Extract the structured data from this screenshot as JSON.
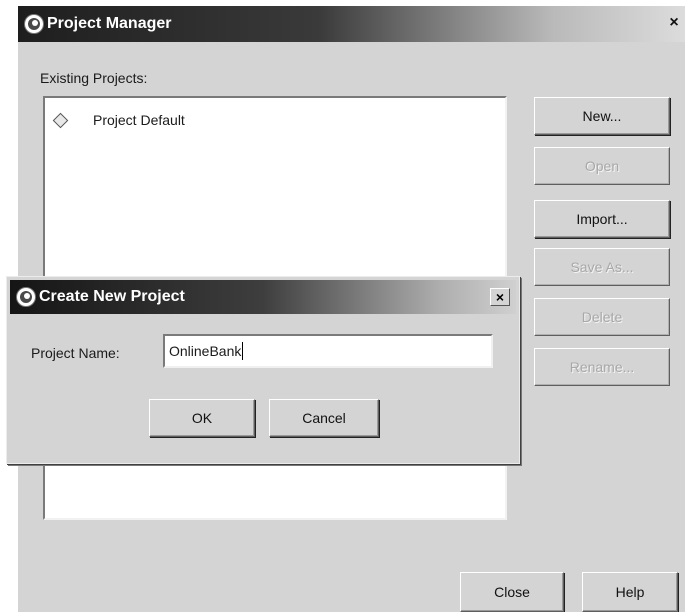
{
  "project_manager": {
    "title": "Project Manager",
    "close_glyph": "×",
    "existing_label": "Existing Projects:",
    "projects": [
      {
        "name": "Project Default",
        "icon": "diamond-icon"
      }
    ],
    "buttons": {
      "new": "New...",
      "open": "Open",
      "import": "Import...",
      "save_as": "Save As...",
      "delete": "Delete",
      "rename": "Rename...",
      "close": "Close",
      "help": "Help"
    }
  },
  "create_dialog": {
    "title": "Create New Project",
    "close_glyph": "×",
    "name_label": "Project Name:",
    "name_value": "OnlineBank",
    "ok": "OK",
    "cancel": "Cancel"
  }
}
